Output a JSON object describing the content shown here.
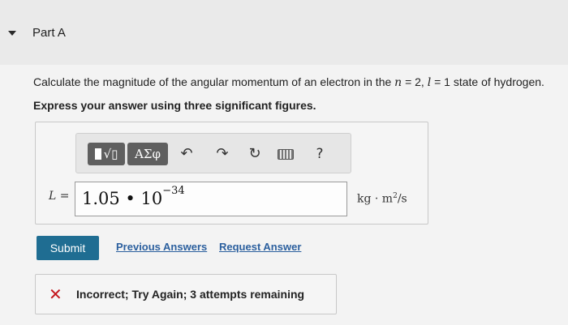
{
  "part": {
    "title": "Part A"
  },
  "question": {
    "text_before": "Calculate the magnitude of the angular momentum of an electron in the ",
    "n_var": "n",
    "n_val": " = 2, ",
    "l_var": "l",
    "l_val": " = 1 state of hydrogen.",
    "instruction": "Express your answer using three significant figures."
  },
  "toolbar": {
    "template_label": "√▯",
    "greek_label": "ΑΣφ",
    "undo_icon": "undo-icon",
    "redo_icon": "redo-icon",
    "reset_icon": "reset-icon",
    "keyboard_icon": "keyboard-icon",
    "help_label": "?"
  },
  "answer": {
    "variable": "L",
    "equals": " =",
    "mantissa": "1.05 • 10",
    "exponent": "−34",
    "units_base": "kg · m",
    "units_exp": "2",
    "units_tail": "/s"
  },
  "actions": {
    "submit": "Submit",
    "previous_answers": "Previous Answers",
    "request_answer": "Request Answer"
  },
  "feedback": {
    "icon": "incorrect-x-icon",
    "message": "Incorrect; Try Again; 3 attempts remaining",
    "color": "#c4161c"
  },
  "colors": {
    "submit_bg": "#1f6d92",
    "link": "#2b5f9e",
    "toolbar_button": "#5f5f5f"
  }
}
